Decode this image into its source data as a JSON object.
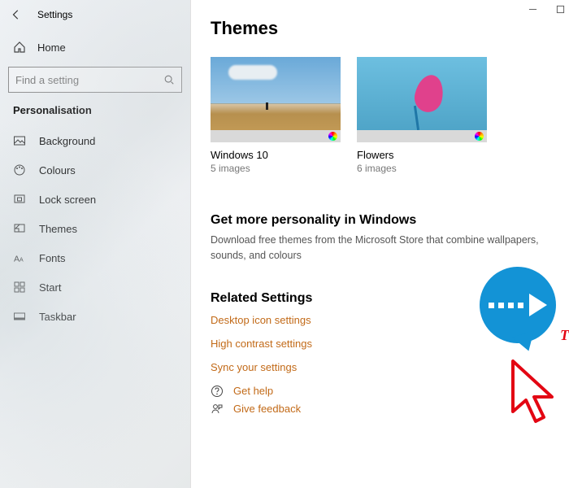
{
  "window": {
    "title": "Settings"
  },
  "sidebar": {
    "home": "Home",
    "search_placeholder": "Find a setting",
    "category": "Personalisation",
    "items": [
      {
        "label": "Background"
      },
      {
        "label": "Colours"
      },
      {
        "label": "Lock screen"
      },
      {
        "label": "Themes",
        "selected": true
      },
      {
        "label": "Fonts"
      },
      {
        "label": "Start"
      },
      {
        "label": "Taskbar"
      }
    ]
  },
  "page": {
    "title": "Themes",
    "themes": [
      {
        "name": "Windows 10",
        "sub": "5 images"
      },
      {
        "name": "Flowers",
        "sub": "6 images"
      }
    ],
    "more": {
      "heading": "Get more personality in Windows",
      "text": "Download free themes from the Microsoft Store that combine wallpapers, sounds, and colours"
    },
    "related": {
      "heading": "Related Settings",
      "links": [
        "Desktop icon settings",
        "High contrast settings",
        "Sync your settings"
      ]
    },
    "help": [
      {
        "label": "Get help"
      },
      {
        "label": "Give feedback"
      }
    ]
  },
  "annotation": {
    "watermark": "TheTechMentor.com"
  }
}
